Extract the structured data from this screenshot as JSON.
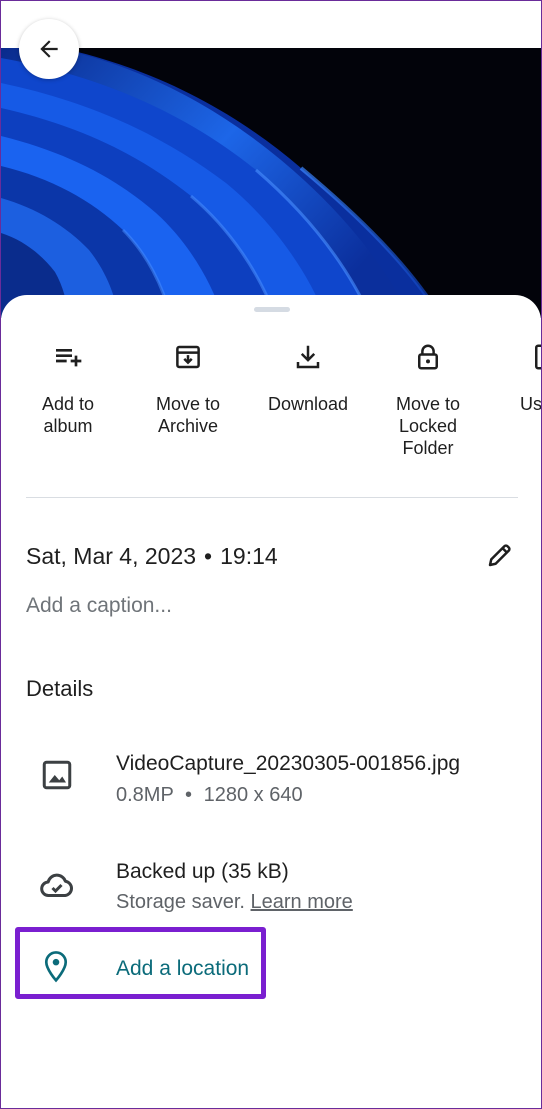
{
  "actions": [
    {
      "label_line1": "Add to",
      "label_line2": "album",
      "label_line3": "",
      "icon": "playlist-add-icon"
    },
    {
      "label_line1": "Move to",
      "label_line2": "Archive",
      "label_line3": "",
      "icon": "archive-icon"
    },
    {
      "label_line1": "Download",
      "label_line2": "",
      "label_line3": "",
      "icon": "download-icon"
    },
    {
      "label_line1": "Move to",
      "label_line2": "Locked",
      "label_line3": "Folder",
      "icon": "lock-icon"
    },
    {
      "label_line1": "Us",
      "label_line2": "",
      "label_line3": "",
      "icon": "use-as-icon"
    }
  ],
  "info": {
    "date": "Sat, Mar 4, 2023",
    "separator": "•",
    "time": "19:14",
    "caption_placeholder": "Add a caption..."
  },
  "details": {
    "title": "Details",
    "file": {
      "name": "VideoCapture_20230305-001856.jpg",
      "megapixels": "0.8MP",
      "separator": "•",
      "resolution": "1280 x 640"
    },
    "backup": {
      "status": "Backed up (35 kB)",
      "mode": "Storage saver.",
      "link": "Learn more"
    },
    "location": {
      "label": "Add a location"
    }
  },
  "colors": {
    "accent_link": "#0b6b7a",
    "highlight_box": "#7a1fd0"
  }
}
